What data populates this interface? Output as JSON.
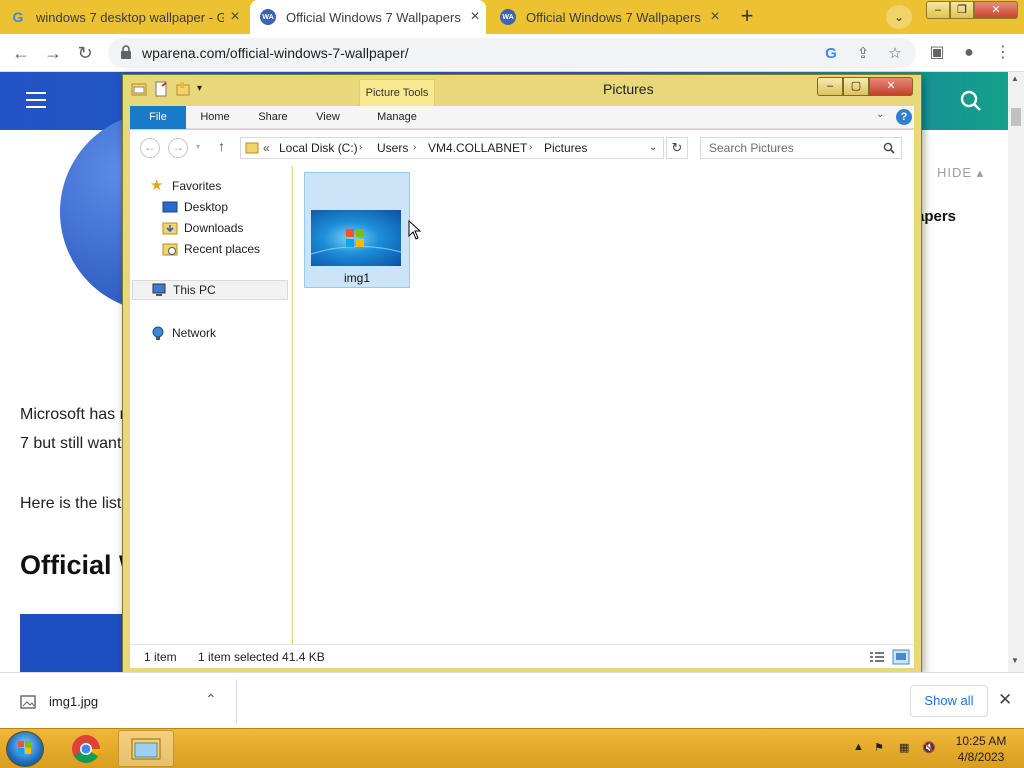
{
  "browser": {
    "tabs": [
      {
        "title": "windows 7 desktop wallpaper - G",
        "favicon": "google-icon",
        "active": false
      },
      {
        "title": "Official Windows 7 Wallpapers -",
        "favicon": "wpa-icon",
        "active": true
      },
      {
        "title": "Official Windows 7 Wallpapers -",
        "favicon": "wpa-icon",
        "active": false
      }
    ],
    "url": "wparena.com/official-windows-7-wallpaper/",
    "new_tab_label": "+"
  },
  "webpage": {
    "hide_label": "HIDE",
    "aside_title": "apers",
    "para1_line1": "Microsoft has r",
    "para1_line2": "7 but still want",
    "para2": "Here is the list",
    "heading": "Official W"
  },
  "explorer": {
    "title": "Pictures",
    "contextual_tab": "Picture Tools",
    "ribbon_tabs": [
      "File",
      "Home",
      "Share",
      "View",
      "Manage"
    ],
    "breadcrumb": [
      "Local Disk (C:)",
      "Users",
      "VM4.COLLABNET",
      "Pictures"
    ],
    "breadcrumb_prefix": "«",
    "search_placeholder": "Search Pictures",
    "nav": {
      "favorites": "Favorites",
      "desktop": "Desktop",
      "downloads": "Downloads",
      "recent": "Recent places",
      "this_pc": "This PC",
      "network": "Network"
    },
    "files": [
      {
        "name": "img1",
        "selected": true
      }
    ],
    "status": {
      "count": "1 item",
      "selection": "1 item selected  41.4 KB"
    }
  },
  "download_shelf": {
    "file": "img1.jpg",
    "show_all": "Show all"
  },
  "taskbar": {
    "time": "10:25 AM",
    "date": "4/8/2023"
  },
  "colors": {
    "tabstrip": "#ecc233",
    "site_header": "#2352c6",
    "file_tab": "#1979ca",
    "selection": "#cce4f7",
    "taskbar": "#e3a62a"
  }
}
